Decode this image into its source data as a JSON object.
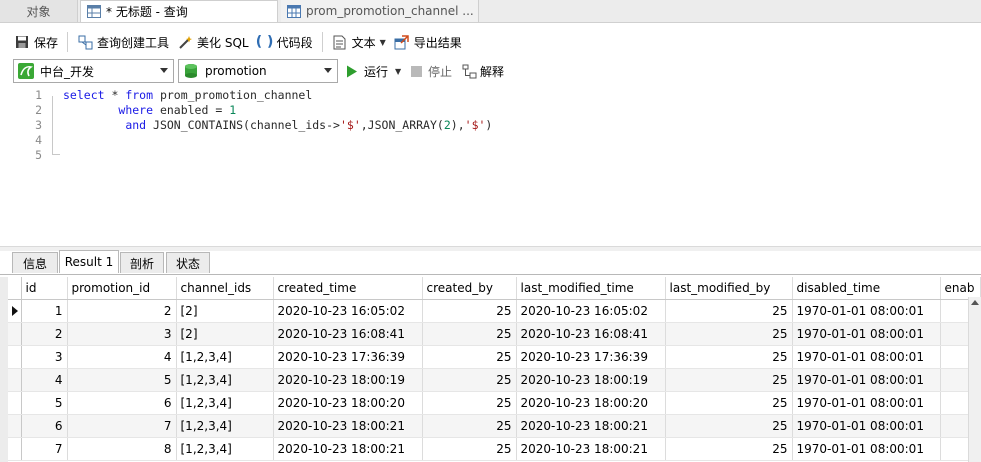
{
  "tabs": [
    {
      "label": "对象"
    },
    {
      "label": "* 无标题 - 查询"
    },
    {
      "label": "prom_promotion_channel ..."
    }
  ],
  "toolbar": {
    "save": "保存",
    "query_builder": "查询创建工具",
    "beautify": "美化 SQL",
    "snippet": "代码段",
    "text": "文本",
    "export": "导出结果"
  },
  "connection": {
    "conn_value": "中台_开发",
    "db_value": "promotion",
    "run": "运行",
    "stop": "停止",
    "explain": "解释"
  },
  "editor": {
    "line_numbers": [
      "1",
      "2",
      "3",
      "4",
      "5"
    ],
    "lines": [
      "select * from prom_promotion_channel",
      "        where enabled = 1",
      "         and JSON_CONTAINS(channel_ids->'$',JSON_ARRAY(2),'$')",
      "",
      ""
    ]
  },
  "result_tabs": [
    "信息",
    "Result 1",
    "剖析",
    "状态"
  ],
  "grid": {
    "columns": [
      "id",
      "promotion_id",
      "channel_ids",
      "created_time",
      "created_by",
      "last_modified_time",
      "last_modified_by",
      "disabled_time",
      "enab"
    ],
    "rows": [
      [
        "1",
        "2",
        "[2]",
        "2020-10-23 16:05:02",
        "25",
        "2020-10-23 16:05:02",
        "25",
        "1970-01-01 08:00:01"
      ],
      [
        "2",
        "3",
        "[2]",
        "2020-10-23 16:08:41",
        "25",
        "2020-10-23 16:08:41",
        "25",
        "1970-01-01 08:00:01"
      ],
      [
        "3",
        "4",
        "[1,2,3,4]",
        "2020-10-23 17:36:39",
        "25",
        "2020-10-23 17:36:39",
        "25",
        "1970-01-01 08:00:01"
      ],
      [
        "4",
        "5",
        "[1,2,3,4]",
        "2020-10-23 18:00:19",
        "25",
        "2020-10-23 18:00:19",
        "25",
        "1970-01-01 08:00:01"
      ],
      [
        "5",
        "6",
        "[1,2,3,4]",
        "2020-10-23 18:00:20",
        "25",
        "2020-10-23 18:00:20",
        "25",
        "1970-01-01 08:00:01"
      ],
      [
        "6",
        "7",
        "[1,2,3,4]",
        "2020-10-23 18:00:21",
        "25",
        "2020-10-23 18:00:21",
        "25",
        "1970-01-01 08:00:01"
      ],
      [
        "7",
        "8",
        "[1,2,3,4]",
        "2020-10-23 18:00:21",
        "25",
        "2020-10-23 18:00:21",
        "25",
        "1970-01-01 08:00:01"
      ]
    ]
  },
  "colors": {
    "keyword": "#1a1ae6",
    "string": "#a31515",
    "number": "#098658",
    "run_green": "#2e9e2e"
  }
}
